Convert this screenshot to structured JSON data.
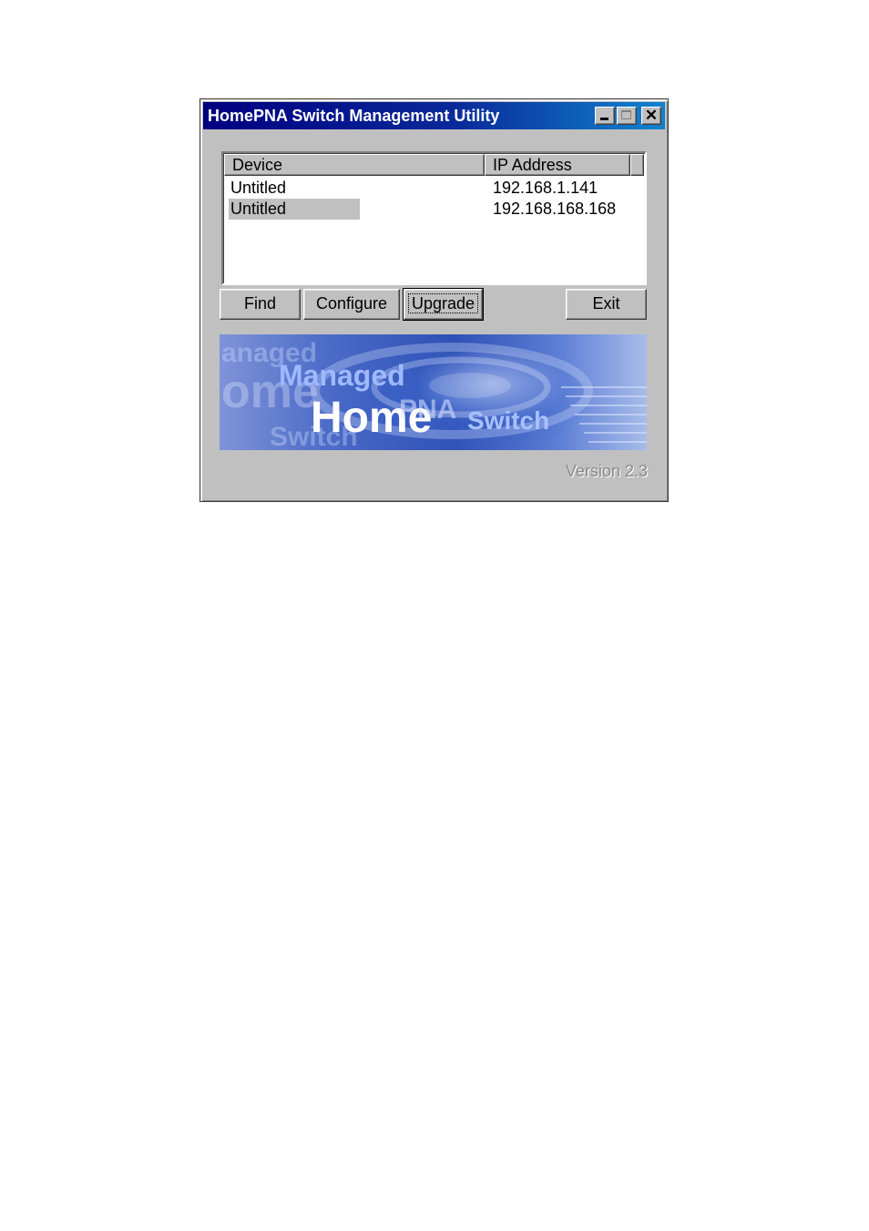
{
  "window": {
    "title": "HomePNA Switch Management Utility",
    "controls": {
      "minimize": "minimize-icon",
      "maximize": "maximize-icon",
      "close": "close-icon"
    }
  },
  "device_list": {
    "columns": [
      "Device",
      "IP Address"
    ],
    "rows": [
      {
        "device": "Untitled",
        "ip": "192.168.1.141",
        "selected": false
      },
      {
        "device": "Untitled",
        "ip": "192.168.168.168",
        "selected": true
      }
    ]
  },
  "buttons": {
    "find": "Find",
    "configure": "Configure",
    "upgrade": "Upgrade",
    "exit": "Exit"
  },
  "banner": {
    "line_managed": "Managed",
    "line_home": "Home",
    "line_pna": "PNA",
    "line_switch": "Switch",
    "ghost_managed": "anaged",
    "ghost_home": "ome",
    "ghost_switch": "Switch"
  },
  "version": "Version 2.3",
  "colors": {
    "titlebar": "#000080",
    "face": "#c0c0c0",
    "banner": "#2e4fb4"
  }
}
